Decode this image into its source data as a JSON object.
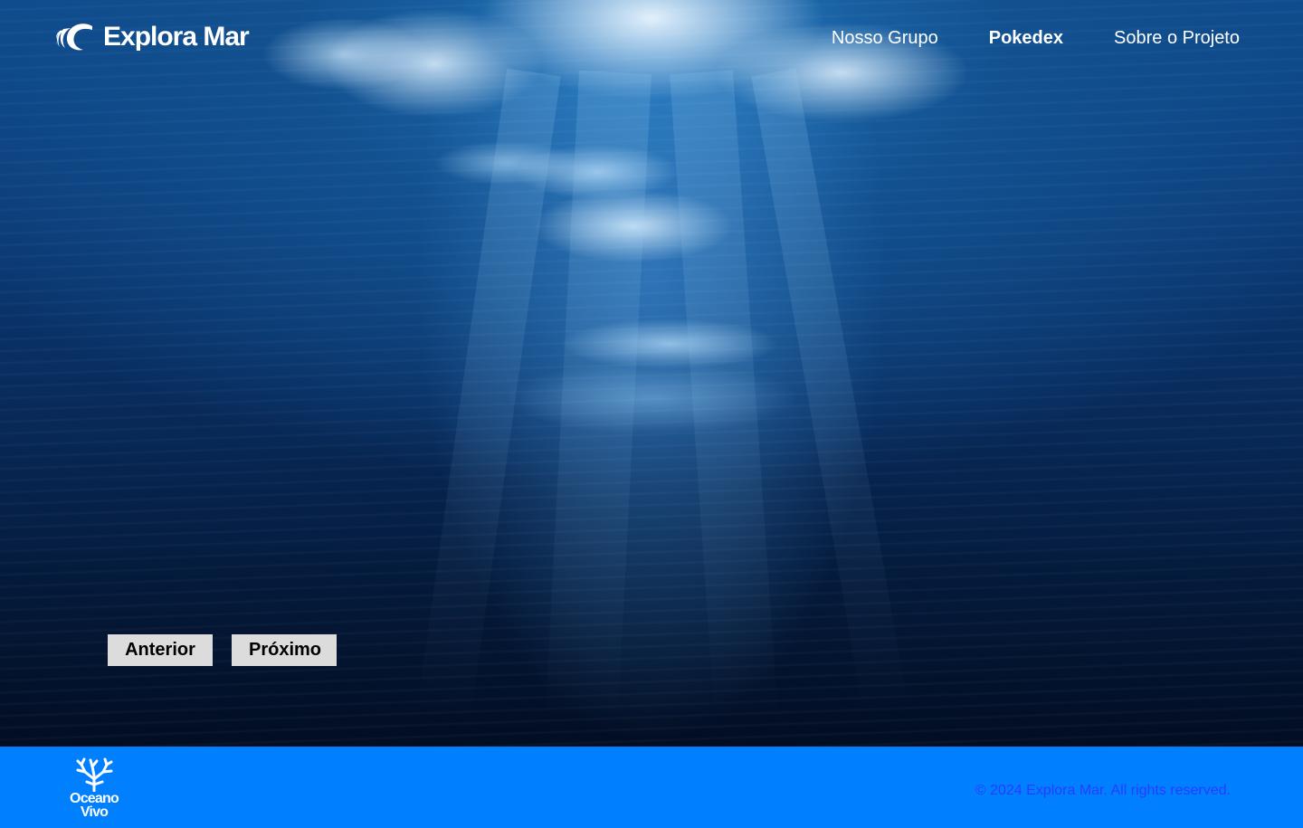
{
  "brand": {
    "name": "Explora Mar",
    "logo_icon": "wave-icon"
  },
  "nav": {
    "items": [
      {
        "label": "Nosso Grupo",
        "active": false
      },
      {
        "label": "Pokedex",
        "active": true
      },
      {
        "label": "Sobre o Projeto",
        "active": false
      }
    ]
  },
  "pager": {
    "prev_label": "Anterior",
    "next_label": "Próximo"
  },
  "footer": {
    "logo_icon": "coral-icon",
    "logo_line1": "Oceano",
    "logo_line2": "Vivo",
    "copyright": "© 2024 Explora Mar. All rights reserved.",
    "background_color": "#0080ff",
    "copyright_color": "#2a3bff"
  },
  "hero": {
    "description_colors": [
      "#0d4a8c",
      "#020d22"
    ]
  }
}
